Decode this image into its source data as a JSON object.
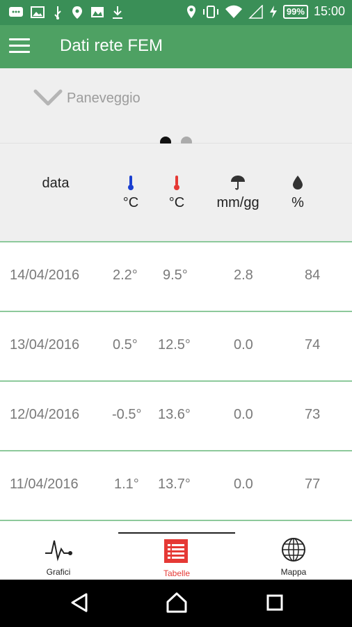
{
  "status_bar": {
    "battery": "99%",
    "time": "15:00"
  },
  "app_bar": {
    "title": "Dati rete FEM",
    "menu_icon": "hamburger-menu-icon"
  },
  "station": {
    "name": "Paneveggio",
    "dots_total": 2,
    "dots_active": 1
  },
  "table": {
    "headers": [
      {
        "label": "data",
        "icon": ""
      },
      {
        "label": "°C",
        "icon": "thermometer-min-icon",
        "color": "#1a3fd0"
      },
      {
        "label": "°C",
        "icon": "thermometer-max-icon",
        "color": "#e53935"
      },
      {
        "label": "mm/gg",
        "icon": "umbrella-icon"
      },
      {
        "label": "%",
        "icon": "water-drop-icon"
      }
    ],
    "rows": [
      {
        "date": "14/04/2016",
        "tmin": "2.2°",
        "tmax": "9.5°",
        "rain": "2.8",
        "hum": "84"
      },
      {
        "date": "13/04/2016",
        "tmin": "0.5°",
        "tmax": "12.5°",
        "rain": "0.0",
        "hum": "74"
      },
      {
        "date": "12/04/2016",
        "tmin": "-0.5°",
        "tmax": "13.6°",
        "rain": "0.0",
        "hum": "73"
      },
      {
        "date": "11/04/2016",
        "tmin": "1.1°",
        "tmax": "13.7°",
        "rain": "0.0",
        "hum": "77"
      }
    ]
  },
  "bottom_nav": {
    "items": [
      {
        "label": "Grafici",
        "icon": "chart-pulse-icon"
      },
      {
        "label": "Tabelle",
        "icon": "table-list-icon",
        "active": true
      },
      {
        "label": "Mappa",
        "icon": "globe-icon"
      }
    ]
  },
  "colors": {
    "status_bar": "#3a8f57",
    "app_bar": "#4ea163",
    "divider": "#8dc99b",
    "active": "#e53935"
  }
}
